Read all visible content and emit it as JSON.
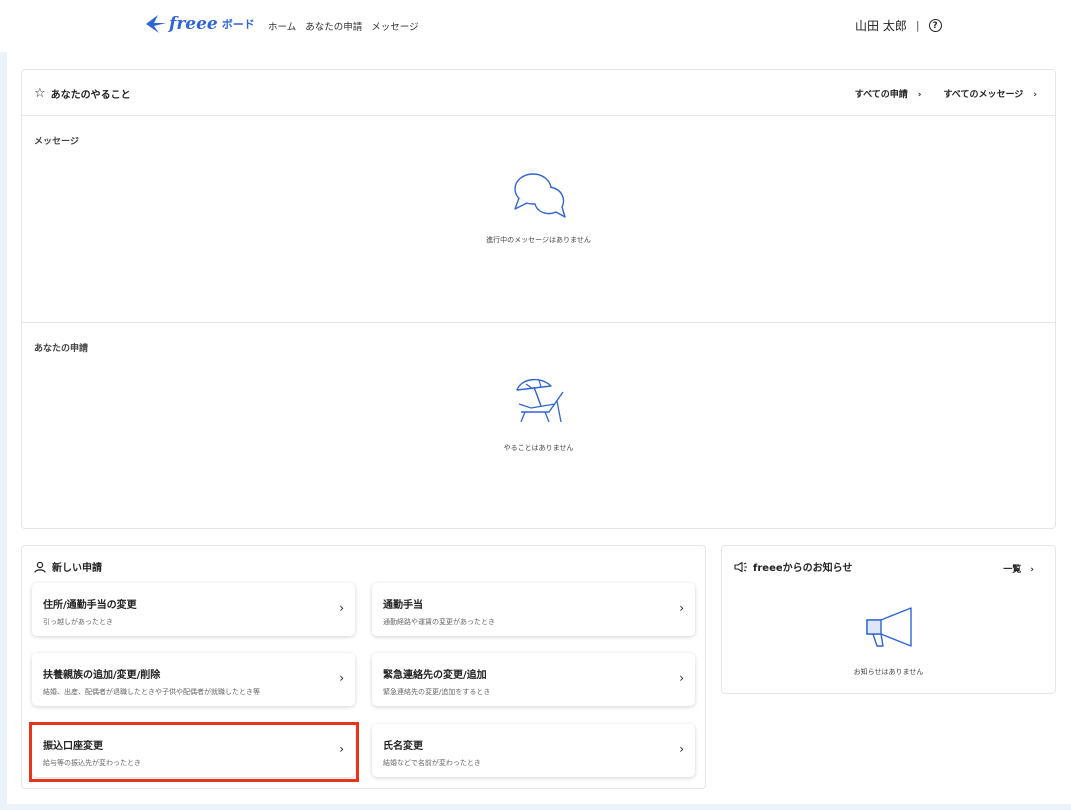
{
  "header": {
    "logo_text": "freee",
    "logo_sub": "ボード",
    "nav": [
      "ホーム",
      "あなたの申請",
      "メッセージ"
    ],
    "user_name": "山田 太郎",
    "separator": "|",
    "help_icon": "?"
  },
  "todo": {
    "title": "あなたのやること",
    "link_all_applications": "すべての申請",
    "link_all_messages": "すべてのメッセージ",
    "messages_label": "メッセージ",
    "messages_empty": "進行中のメッセージはありません",
    "applications_label": "あなたの申請",
    "applications_empty": "やることはありません"
  },
  "new_application": {
    "title": "新しい申請",
    "items": [
      {
        "title": "住所/通勤手当の変更",
        "desc": "引っ越しがあったとき"
      },
      {
        "title": "通勤手当",
        "desc": "通勤経路や運賃の変更があったとき"
      },
      {
        "title": "扶養親族の追加/変更/削除",
        "desc": "結婚、出産、配偶者が退職したときや子供や配偶者が就職したとき等"
      },
      {
        "title": "緊急連絡先の変更/追加",
        "desc": "緊急連絡先の変更/追加をするとき"
      },
      {
        "title": "振込口座変更",
        "desc": "給与等の振込先が変わったとき"
      },
      {
        "title": "氏名変更",
        "desc": "結婚などで名前が変わったとき"
      }
    ]
  },
  "news": {
    "title": "freeeからのお知らせ",
    "link": "一覧",
    "empty": "お知らせはありません"
  },
  "colors": {
    "brand": "#2f65d6",
    "highlight": "#e5361d",
    "page_bg": "#eaf3f8"
  }
}
